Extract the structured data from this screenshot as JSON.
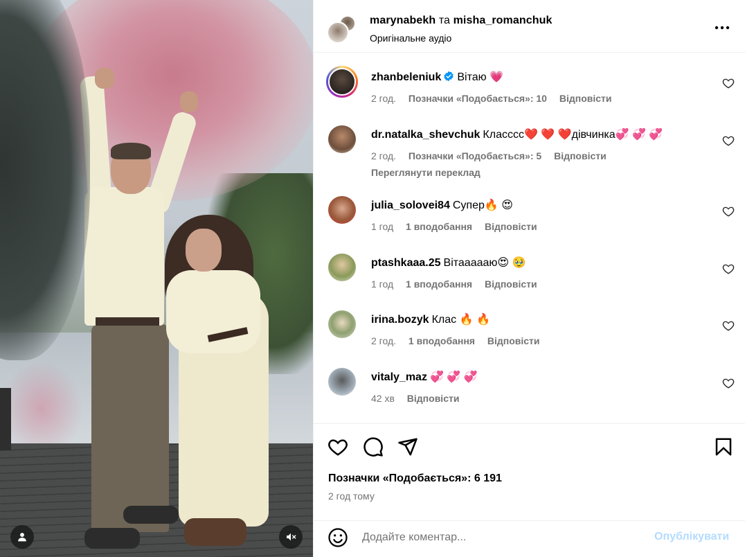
{
  "header": {
    "user1": "marynabekh",
    "conjunction": "та",
    "user2": "misha_romanchuk",
    "audio": "Оригінальне аудіо",
    "more_icon": "more-horizontal-icon"
  },
  "comments": [
    {
      "user": "zhanbeleniuk",
      "verified": true,
      "text": "Вітаю 💗",
      "time": "2 год.",
      "likes": "Позначки «Подобається»: 10",
      "reply": "Відповісти",
      "translate": ""
    },
    {
      "user": "dr.natalka_shevchuk",
      "verified": false,
      "text": "Класссс❤️ ❤️ ❤️дівчинка💞 💞 💞",
      "time": "2 год.",
      "likes": "Позначки «Подобається»: 5",
      "reply": "Відповісти",
      "translate": "Переглянути переклад"
    },
    {
      "user": "julia_solovei84",
      "verified": false,
      "text": "Супер🔥 😍",
      "time": "1 год",
      "likes": "1 вподобання",
      "reply": "Відповісти",
      "translate": ""
    },
    {
      "user": "ptashkaaa.25",
      "verified": false,
      "text": "Вітаааааю😍 🥹",
      "time": "1 год",
      "likes": "1 вподобання",
      "reply": "Відповісти",
      "translate": ""
    },
    {
      "user": "irina.bozyk",
      "verified": false,
      "text": "Клас 🔥 🔥",
      "time": "2 год.",
      "likes": "1 вподобання",
      "reply": "Відповісти",
      "translate": ""
    },
    {
      "user": "vitaly_maz",
      "verified": false,
      "text": "💞 💞 💞",
      "time": "42 хв",
      "likes": "",
      "reply": "Відповісти",
      "translate": ""
    }
  ],
  "actions": {
    "like_icon": "heart-icon",
    "comment_icon": "comment-icon",
    "share_icon": "send-icon",
    "save_icon": "bookmark-icon",
    "likes": "Позначки «Подобається»: 6 191",
    "posted": "2 год тому"
  },
  "composer": {
    "placeholder": "Додайте коментар...",
    "publish": "Опублікувати",
    "emoji_icon": "emoji-icon"
  },
  "media": {
    "tag_icon": "user-tag-icon",
    "mute_icon": "muted-speaker-icon"
  },
  "colors": {
    "accent_disabled": "#b3dbff",
    "verified": "#0095f6",
    "secondary_text": "#737373"
  }
}
